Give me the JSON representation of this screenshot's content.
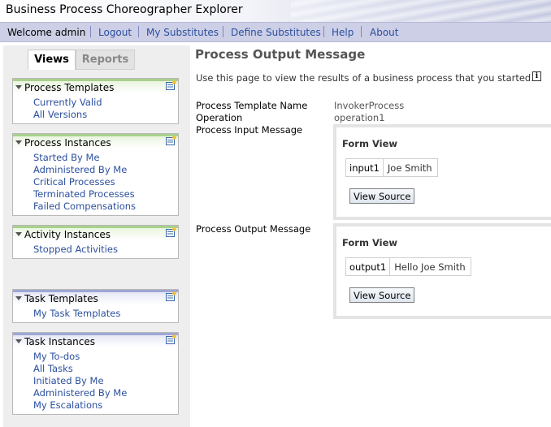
{
  "window": {
    "title": "Business Process Choreographer Explorer"
  },
  "nav": {
    "welcome": "Welcome admin",
    "links": [
      "Logout",
      "My Substitutes",
      "Define Substitutes",
      "Help",
      "About"
    ]
  },
  "tabs": {
    "views": "Views",
    "reports": "Reports",
    "selected": "Views"
  },
  "sidebar": {
    "groups": [
      {
        "title": "Process Templates",
        "items": [
          "Currently Valid",
          "All Versions"
        ]
      },
      {
        "title": "Process Instances",
        "items": [
          "Started By Me",
          "Administered By Me",
          "Critical Processes",
          "Terminated Processes",
          "Failed Compensations"
        ]
      },
      {
        "title": "Activity Instances",
        "items": [
          "Stopped Activities"
        ]
      },
      {
        "title": "Task Templates",
        "items": [
          "My Task Templates"
        ]
      },
      {
        "title": "Task Instances",
        "items": [
          "My To-dos",
          "All Tasks",
          "Initiated By Me",
          "Administered By Me",
          "My Escalations"
        ]
      }
    ]
  },
  "main": {
    "title": "Process Output Message",
    "description": "Use this page to view the results of a business process that you started.",
    "info_icon": "i",
    "fields": {
      "template_name_label": "Process Template Name",
      "template_name_value": "InvokerProcess",
      "operation_label": "Operation",
      "operation_value": "operation1",
      "input_label": "Process Input Message",
      "output_label": "Process Output Message"
    },
    "input_form": {
      "title": "Form View",
      "field_name": "input1",
      "field_value": "Joe Smith",
      "button": "View Source"
    },
    "output_form": {
      "title": "Form View",
      "field_name": "output1",
      "field_value": "Hello Joe Smith",
      "button": "View Source"
    }
  },
  "colors": {
    "link": "#2b4f9e",
    "navbar": "#cdcfe6",
    "green_accent": "#a9d18e",
    "blue_accent": "#9fa7d6"
  },
  "icons": {
    "box_action": "new-item-icon",
    "collapse": "triangle-down-icon"
  }
}
